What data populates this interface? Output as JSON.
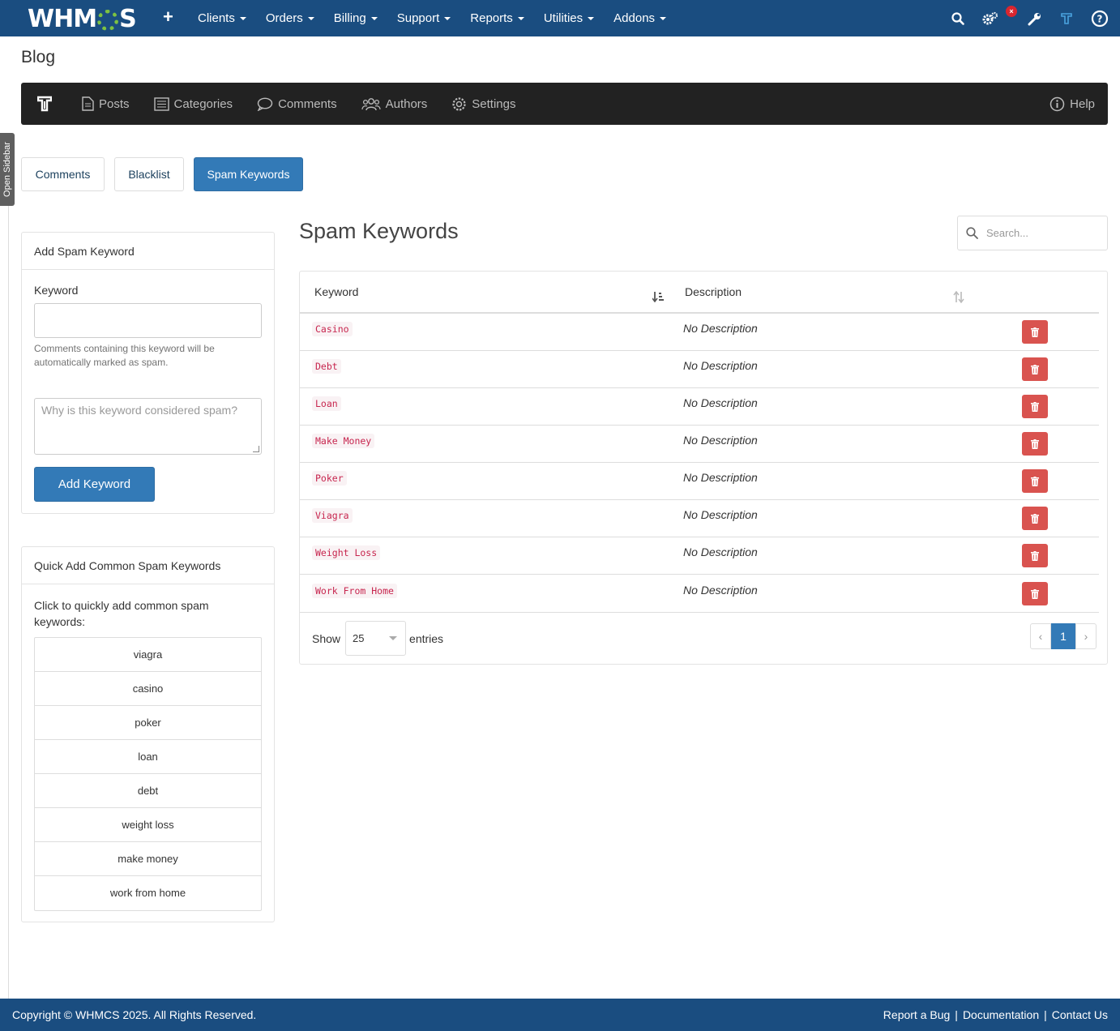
{
  "topnav": {
    "logo_text_left": "WHM",
    "logo_text_right": "S",
    "menu": [
      "Clients",
      "Orders",
      "Billing",
      "Support",
      "Reports",
      "Utilities",
      "Addons"
    ],
    "icons": [
      "search-icon",
      "settings-cogs-icon",
      "wrench-icon",
      "blog-addon-icon",
      "help-circle-icon"
    ],
    "alert_badge": "×"
  },
  "sidebar_toggle": "Open Sidebar",
  "page_title": "Blog",
  "blognav": {
    "items": [
      "Posts",
      "Categories",
      "Comments",
      "Authors",
      "Settings"
    ],
    "help": "Help"
  },
  "tabs": [
    "Comments",
    "Blacklist",
    "Spam Keywords"
  ],
  "add_panel": {
    "title": "Add Spam Keyword",
    "keyword_label": "Keyword",
    "keyword_value": "",
    "help_text": "Comments containing this keyword will be automatically marked as spam.",
    "description_placeholder": "Why is this keyword considered spam?",
    "button": "Add Keyword"
  },
  "quick_panel": {
    "title": "Quick Add Common Spam Keywords",
    "intro": "Click to quickly add common spam keywords:",
    "items": [
      "viagra",
      "casino",
      "poker",
      "loan",
      "debt",
      "weight loss",
      "make money",
      "work from home"
    ]
  },
  "main": {
    "title": "Spam Keywords",
    "search_placeholder": "Search...",
    "columns": [
      "Keyword",
      "Description"
    ],
    "rows": [
      {
        "keyword": "Casino",
        "description": "No Description"
      },
      {
        "keyword": "Debt",
        "description": "No Description"
      },
      {
        "keyword": "Loan",
        "description": "No Description"
      },
      {
        "keyword": "Make Money",
        "description": "No Description"
      },
      {
        "keyword": "Poker",
        "description": "No Description"
      },
      {
        "keyword": "Viagra",
        "description": "No Description"
      },
      {
        "keyword": "Weight Loss",
        "description": "No Description"
      },
      {
        "keyword": "Work From Home",
        "description": "No Description"
      }
    ],
    "show_label": "Show",
    "page_length": "25",
    "entries_label": "entries",
    "pagination": {
      "prev": "‹",
      "current": "1",
      "next": "›"
    }
  },
  "footer": {
    "copyright": "Copyright © WHMCS 2025. All Rights Reserved.",
    "links": [
      "Report a Bug",
      "Documentation",
      "Contact Us"
    ]
  },
  "colors": {
    "nav_blue": "#1a4d80",
    "primary": "#337ab7",
    "danger": "#d9534f",
    "dark_nav": "#222222",
    "logo_gear": "#7cc242"
  }
}
